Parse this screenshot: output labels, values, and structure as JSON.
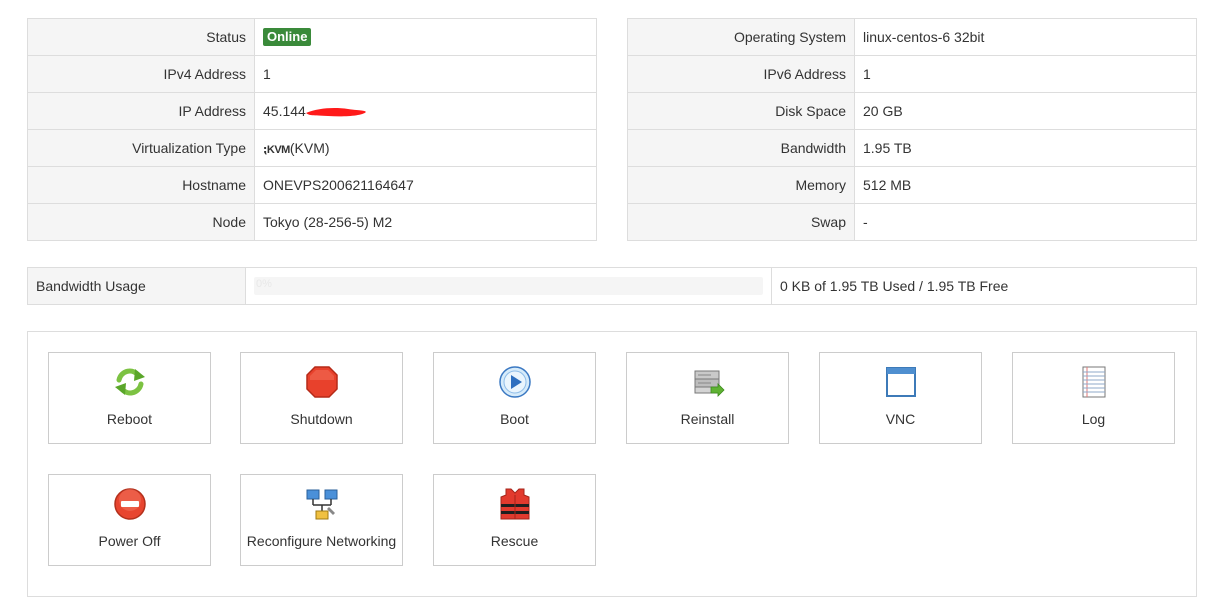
{
  "left_table": {
    "rows": [
      {
        "label": "Status",
        "value": "Online"
      },
      {
        "label": "IPv4 Address",
        "value": "1"
      },
      {
        "label": "IP Address",
        "value": "45.144"
      },
      {
        "label": "Virtualization Type",
        "logo": "KVM",
        "value": "(KVM)"
      },
      {
        "label": "Hostname",
        "value": "ONEVPS200621164647"
      },
      {
        "label": "Node",
        "value": "Tokyo (28-256-5) M2"
      }
    ]
  },
  "right_table": {
    "rows": [
      {
        "label": "Operating System",
        "value": "linux-centos-6 32bit"
      },
      {
        "label": "IPv6 Address",
        "value": "1"
      },
      {
        "label": "Disk Space",
        "value": "20 GB"
      },
      {
        "label": "Bandwidth",
        "value": "1.95 TB"
      },
      {
        "label": "Memory",
        "value": "512 MB"
      },
      {
        "label": "Swap",
        "value": "-"
      }
    ]
  },
  "bandwidth_usage": {
    "label": "Bandwidth Usage",
    "percent_text": "0%",
    "percent": 0,
    "summary": "0 KB of 1.95 TB Used / 1.95 TB Free"
  },
  "actions": [
    {
      "label": "Reboot",
      "icon": "reboot-icon"
    },
    {
      "label": "Shutdown",
      "icon": "shutdown-icon"
    },
    {
      "label": "Boot",
      "icon": "boot-icon"
    },
    {
      "label": "Reinstall",
      "icon": "reinstall-icon"
    },
    {
      "label": "VNC",
      "icon": "vnc-icon"
    },
    {
      "label": "Log",
      "icon": "log-icon"
    },
    {
      "label": "Power Off",
      "icon": "power-off-icon"
    },
    {
      "label": "Reconfigure Networking",
      "icon": "network-icon"
    },
    {
      "label": "Rescue",
      "icon": "rescue-icon"
    }
  ],
  "colors": {
    "online_badge": "#3a8a3a",
    "border": "#dddddd",
    "label_bg": "#f5f5f5",
    "redaction": "#ff1a1a"
  }
}
